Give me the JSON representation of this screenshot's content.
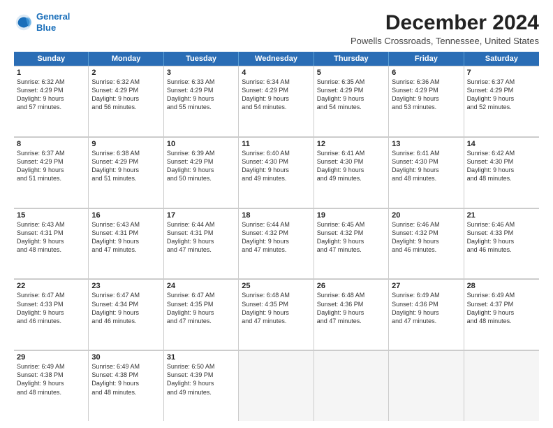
{
  "logo": {
    "line1": "General",
    "line2": "Blue"
  },
  "title": "December 2024",
  "subtitle": "Powells Crossroads, Tennessee, United States",
  "header_days": [
    "Sunday",
    "Monday",
    "Tuesday",
    "Wednesday",
    "Thursday",
    "Friday",
    "Saturday"
  ],
  "weeks": [
    [
      {
        "day": "1",
        "lines": [
          "Sunrise: 6:32 AM",
          "Sunset: 4:29 PM",
          "Daylight: 9 hours",
          "and 57 minutes."
        ]
      },
      {
        "day": "2",
        "lines": [
          "Sunrise: 6:32 AM",
          "Sunset: 4:29 PM",
          "Daylight: 9 hours",
          "and 56 minutes."
        ]
      },
      {
        "day": "3",
        "lines": [
          "Sunrise: 6:33 AM",
          "Sunset: 4:29 PM",
          "Daylight: 9 hours",
          "and 55 minutes."
        ]
      },
      {
        "day": "4",
        "lines": [
          "Sunrise: 6:34 AM",
          "Sunset: 4:29 PM",
          "Daylight: 9 hours",
          "and 54 minutes."
        ]
      },
      {
        "day": "5",
        "lines": [
          "Sunrise: 6:35 AM",
          "Sunset: 4:29 PM",
          "Daylight: 9 hours",
          "and 54 minutes."
        ]
      },
      {
        "day": "6",
        "lines": [
          "Sunrise: 6:36 AM",
          "Sunset: 4:29 PM",
          "Daylight: 9 hours",
          "and 53 minutes."
        ]
      },
      {
        "day": "7",
        "lines": [
          "Sunrise: 6:37 AM",
          "Sunset: 4:29 PM",
          "Daylight: 9 hours",
          "and 52 minutes."
        ]
      }
    ],
    [
      {
        "day": "8",
        "lines": [
          "Sunrise: 6:37 AM",
          "Sunset: 4:29 PM",
          "Daylight: 9 hours",
          "and 51 minutes."
        ]
      },
      {
        "day": "9",
        "lines": [
          "Sunrise: 6:38 AM",
          "Sunset: 4:29 PM",
          "Daylight: 9 hours",
          "and 51 minutes."
        ]
      },
      {
        "day": "10",
        "lines": [
          "Sunrise: 6:39 AM",
          "Sunset: 4:29 PM",
          "Daylight: 9 hours",
          "and 50 minutes."
        ]
      },
      {
        "day": "11",
        "lines": [
          "Sunrise: 6:40 AM",
          "Sunset: 4:30 PM",
          "Daylight: 9 hours",
          "and 49 minutes."
        ]
      },
      {
        "day": "12",
        "lines": [
          "Sunrise: 6:41 AM",
          "Sunset: 4:30 PM",
          "Daylight: 9 hours",
          "and 49 minutes."
        ]
      },
      {
        "day": "13",
        "lines": [
          "Sunrise: 6:41 AM",
          "Sunset: 4:30 PM",
          "Daylight: 9 hours",
          "and 48 minutes."
        ]
      },
      {
        "day": "14",
        "lines": [
          "Sunrise: 6:42 AM",
          "Sunset: 4:30 PM",
          "Daylight: 9 hours",
          "and 48 minutes."
        ]
      }
    ],
    [
      {
        "day": "15",
        "lines": [
          "Sunrise: 6:43 AM",
          "Sunset: 4:31 PM",
          "Daylight: 9 hours",
          "and 48 minutes."
        ]
      },
      {
        "day": "16",
        "lines": [
          "Sunrise: 6:43 AM",
          "Sunset: 4:31 PM",
          "Daylight: 9 hours",
          "and 47 minutes."
        ]
      },
      {
        "day": "17",
        "lines": [
          "Sunrise: 6:44 AM",
          "Sunset: 4:31 PM",
          "Daylight: 9 hours",
          "and 47 minutes."
        ]
      },
      {
        "day": "18",
        "lines": [
          "Sunrise: 6:44 AM",
          "Sunset: 4:32 PM",
          "Daylight: 9 hours",
          "and 47 minutes."
        ]
      },
      {
        "day": "19",
        "lines": [
          "Sunrise: 6:45 AM",
          "Sunset: 4:32 PM",
          "Daylight: 9 hours",
          "and 47 minutes."
        ]
      },
      {
        "day": "20",
        "lines": [
          "Sunrise: 6:46 AM",
          "Sunset: 4:32 PM",
          "Daylight: 9 hours",
          "and 46 minutes."
        ]
      },
      {
        "day": "21",
        "lines": [
          "Sunrise: 6:46 AM",
          "Sunset: 4:33 PM",
          "Daylight: 9 hours",
          "and 46 minutes."
        ]
      }
    ],
    [
      {
        "day": "22",
        "lines": [
          "Sunrise: 6:47 AM",
          "Sunset: 4:33 PM",
          "Daylight: 9 hours",
          "and 46 minutes."
        ]
      },
      {
        "day": "23",
        "lines": [
          "Sunrise: 6:47 AM",
          "Sunset: 4:34 PM",
          "Daylight: 9 hours",
          "and 46 minutes."
        ]
      },
      {
        "day": "24",
        "lines": [
          "Sunrise: 6:47 AM",
          "Sunset: 4:35 PM",
          "Daylight: 9 hours",
          "and 47 minutes."
        ]
      },
      {
        "day": "25",
        "lines": [
          "Sunrise: 6:48 AM",
          "Sunset: 4:35 PM",
          "Daylight: 9 hours",
          "and 47 minutes."
        ]
      },
      {
        "day": "26",
        "lines": [
          "Sunrise: 6:48 AM",
          "Sunset: 4:36 PM",
          "Daylight: 9 hours",
          "and 47 minutes."
        ]
      },
      {
        "day": "27",
        "lines": [
          "Sunrise: 6:49 AM",
          "Sunset: 4:36 PM",
          "Daylight: 9 hours",
          "and 47 minutes."
        ]
      },
      {
        "day": "28",
        "lines": [
          "Sunrise: 6:49 AM",
          "Sunset: 4:37 PM",
          "Daylight: 9 hours",
          "and 48 minutes."
        ]
      }
    ],
    [
      {
        "day": "29",
        "lines": [
          "Sunrise: 6:49 AM",
          "Sunset: 4:38 PM",
          "Daylight: 9 hours",
          "and 48 minutes."
        ]
      },
      {
        "day": "30",
        "lines": [
          "Sunrise: 6:49 AM",
          "Sunset: 4:38 PM",
          "Daylight: 9 hours",
          "and 48 minutes."
        ]
      },
      {
        "day": "31",
        "lines": [
          "Sunrise: 6:50 AM",
          "Sunset: 4:39 PM",
          "Daylight: 9 hours",
          "and 49 minutes."
        ]
      },
      {
        "day": "",
        "lines": []
      },
      {
        "day": "",
        "lines": []
      },
      {
        "day": "",
        "lines": []
      },
      {
        "day": "",
        "lines": []
      }
    ]
  ]
}
